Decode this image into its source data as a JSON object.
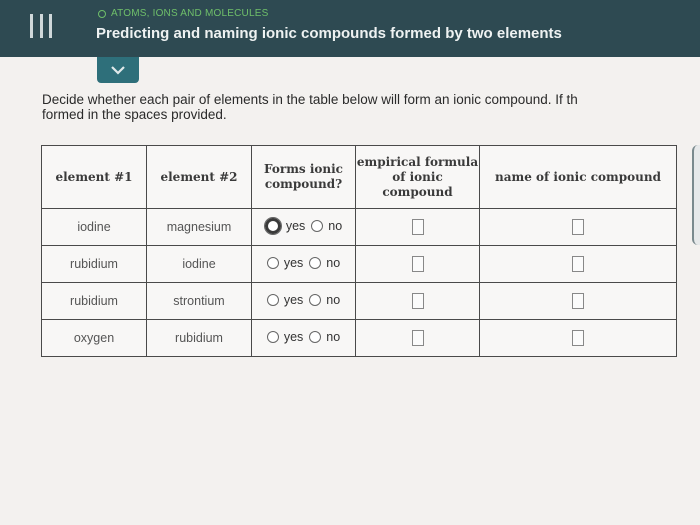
{
  "header": {
    "breadcrumb": "ATOMS, IONS AND MOLECULES",
    "title": "Predicting and naming ionic compounds formed by two elements"
  },
  "instructions": "Decide whether each pair of elements in the table below will form an ionic compound. If th\nformed in the spaces provided.",
  "table": {
    "headers": [
      "element #1",
      "element #2",
      "Forms ionic compound?",
      "empirical formula of ionic compound",
      "name of ionic compound"
    ],
    "rows": [
      {
        "element1": "iodine",
        "element2": "magnesium",
        "yes": "yes",
        "no": "no"
      },
      {
        "element1": "rubidium",
        "element2": "iodine",
        "yes": "yes",
        "no": "no"
      },
      {
        "element1": "rubidium",
        "element2": "strontium",
        "yes": "yes",
        "no": "no"
      },
      {
        "element1": "oxygen",
        "element2": "rubidium",
        "yes": "yes",
        "no": "no"
      }
    ]
  },
  "colors": {
    "header_bg": "#2e4a52",
    "accent": "#2e6f7a",
    "breadcrumb": "#6fbf6a"
  }
}
